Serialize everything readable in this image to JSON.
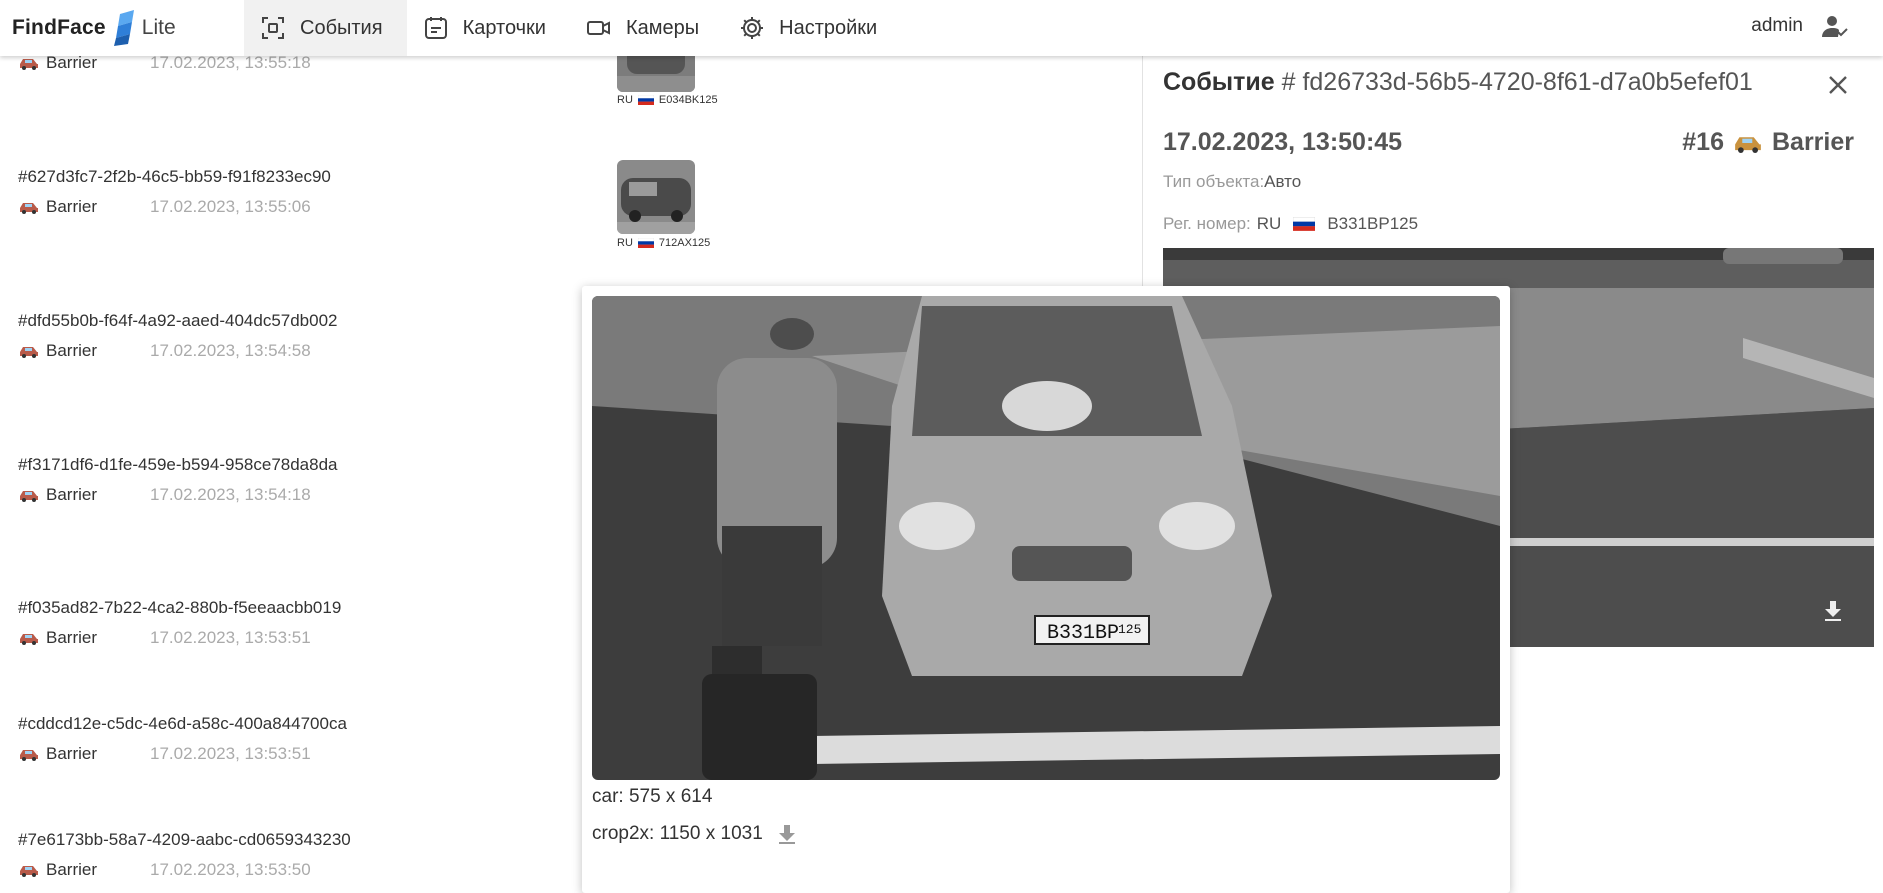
{
  "app": {
    "logo_text": "FindFace",
    "logo_suffix": "Lite"
  },
  "nav": {
    "items": [
      {
        "label": "События",
        "icon": "events-icon",
        "active": true
      },
      {
        "label": "Карточки",
        "icon": "cards-icon",
        "active": false
      },
      {
        "label": "Камеры",
        "icon": "camera-icon",
        "active": false
      },
      {
        "label": "Настройки",
        "icon": "gear-icon",
        "active": false
      }
    ]
  },
  "user": {
    "name": "admin",
    "icon": "user-check-icon"
  },
  "events": [
    {
      "id": "",
      "camera": "Barrier",
      "time": "17.02.2023, 13:55:18"
    },
    {
      "id": "#627d3fc7-2f2b-46c5-bb59-f91f8233ec90",
      "camera": "Barrier",
      "time": "17.02.2023, 13:55:06"
    },
    {
      "id": "#dfd55b0b-f64f-4a92-aaed-404dc57db002",
      "camera": "Barrier",
      "time": "17.02.2023, 13:54:58"
    },
    {
      "id": "#f3171df6-d1fe-459e-b594-958ce78da8da",
      "camera": "Barrier",
      "time": "17.02.2023, 13:54:18"
    },
    {
      "id": "#f035ad82-7b22-4ca2-880b-f5eeaacbb019",
      "camera": "Barrier",
      "time": "17.02.2023, 13:53:51"
    },
    {
      "id": "#cddcd12e-c5dc-4e6d-a58c-400a844700ca",
      "camera": "Barrier",
      "time": "17.02.2023, 13:53:51"
    },
    {
      "id": "#7e6173bb-58a7-4209-aabc-cd0659343230",
      "camera": "Barrier",
      "time": "17.02.2023, 13:53:50"
    }
  ],
  "thumbs": [
    {
      "country": "RU",
      "plate": "E034BK125"
    },
    {
      "country": "RU",
      "plate": "712AX125"
    }
  ],
  "detail": {
    "title_label": "Событие",
    "event_id": "# fd26733d-56b5-4720-8f61-d7a0b5efef01",
    "datetime": "17.02.2023, 13:50:45",
    "camera_number": "#16",
    "camera_name": "Barrier",
    "type_label": "Тип объекта:",
    "type_value": "Авто",
    "plate_label": "Рег. номер:",
    "plate_country": "RU",
    "plate_value": "В331ВР125"
  },
  "popup": {
    "car_size": "car: 575 x 614",
    "crop_size": "crop2x: 1150 x 1031",
    "plate_text": "В331ВР",
    "plate_region": "125"
  },
  "colors": {
    "logo_blue": "#2f7fd8",
    "flag_red": "#d52b1e",
    "flag_blue": "#0039a6"
  }
}
